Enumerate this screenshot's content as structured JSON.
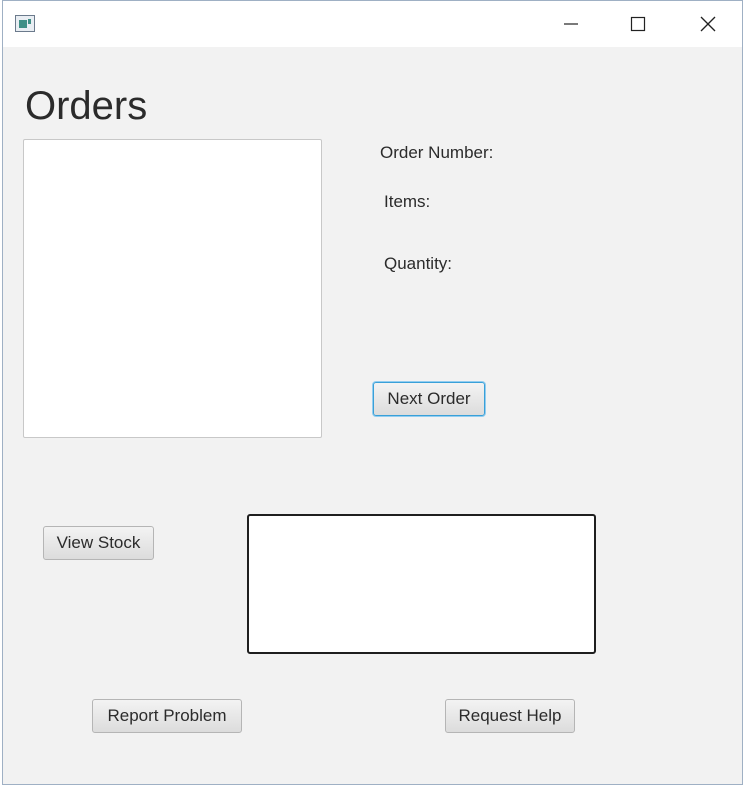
{
  "window": {
    "icons": {
      "app": "app-window-icon",
      "minimize": "minimize-icon",
      "maximize": "maximize-icon",
      "close": "close-icon"
    }
  },
  "main": {
    "title": "Orders",
    "order_number_label": "Order Number:",
    "items_label": "Items:",
    "quantity_label": "Quantity:",
    "next_order_label": "Next Order",
    "view_stock_label": "View Stock",
    "report_problem_label": "Report Problem",
    "request_help_label": "Request Help",
    "notes_value": ""
  },
  "colors": {
    "window_bg": "#f2f2f2",
    "focus_accent": "#39a0d8"
  }
}
